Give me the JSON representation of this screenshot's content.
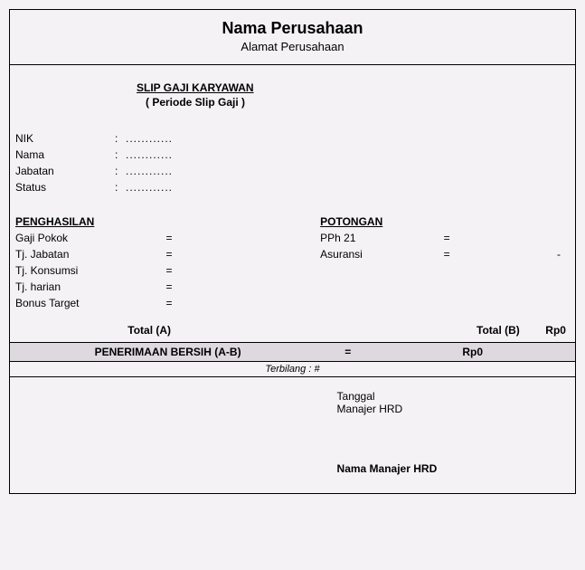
{
  "header": {
    "company_name": "Nama Perusahaan",
    "company_address": "Alamat Perusahaan"
  },
  "title": {
    "main": "SLIP GAJI KARYAWAN",
    "period": "( Periode Slip Gaji )"
  },
  "info": {
    "nik_label": "NIK",
    "nik_value": "............",
    "nama_label": "Nama",
    "nama_value": "............",
    "jabatan_label": "Jabatan",
    "jabatan_value": "............",
    "status_label": "Status",
    "status_value": "............",
    "colon": ":"
  },
  "earnings": {
    "heading": "PENGHASILAN",
    "gaji_pokok_label": "Gaji Pokok",
    "gaji_pokok_value": "",
    "tj_jabatan_label": "Tj. Jabatan",
    "tj_jabatan_value": "",
    "tj_konsumsi_label": "Tj. Konsumsi",
    "tj_konsumsi_value": "",
    "tj_harian_label": "Tj. harian",
    "tj_harian_value": "",
    "bonus_label": "Bonus Target",
    "bonus_value": "",
    "eq": "="
  },
  "deductions": {
    "heading": "POTONGAN",
    "pph21_label": "PPh 21",
    "pph21_value": "",
    "asuransi_label": "Asuransi",
    "asuransi_value": "-",
    "eq": "="
  },
  "totals": {
    "total_a_label": "Total (A)",
    "total_b_label": "Total (B)",
    "total_b_value": "Rp0"
  },
  "net": {
    "label": "PENERIMAAN BERSIH (A-B)",
    "eq": "=",
    "value": "Rp0"
  },
  "terbilang": {
    "text": "Terbilang : #"
  },
  "signature": {
    "date_label": "Tanggal",
    "role": "Manajer HRD",
    "name": "Nama Manajer HRD"
  }
}
